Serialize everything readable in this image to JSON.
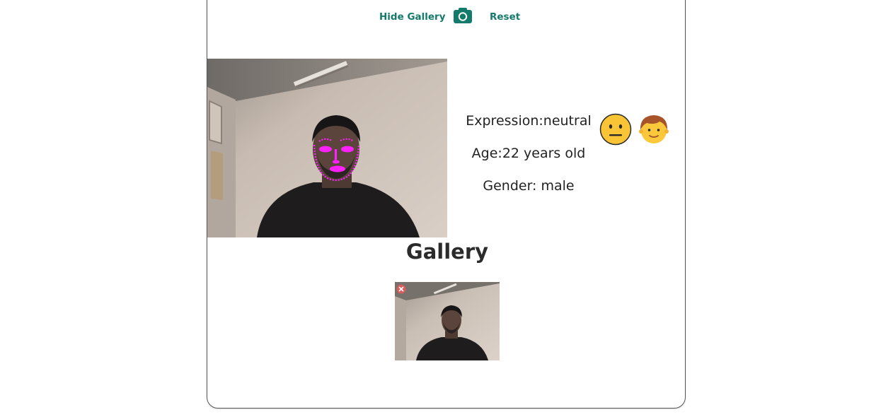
{
  "toolbar": {
    "hide_gallery_label": "Hide Gallery",
    "camera_icon": "camera-icon",
    "reset_label": "Reset"
  },
  "analysis": {
    "expression": "Expression:neutral",
    "age": "Age:22 years old",
    "gender": "Gender: male",
    "expression_emoji_icon": "neutral-face-icon",
    "gender_emoji_icon": "boy-face-icon"
  },
  "gallery": {
    "title": "Gallery",
    "items": [
      {
        "remove_icon": "remove-icon"
      }
    ]
  },
  "colors": {
    "accent": "#147a6b",
    "landmark": "#ff22ff",
    "remove": "#e85a5a"
  }
}
